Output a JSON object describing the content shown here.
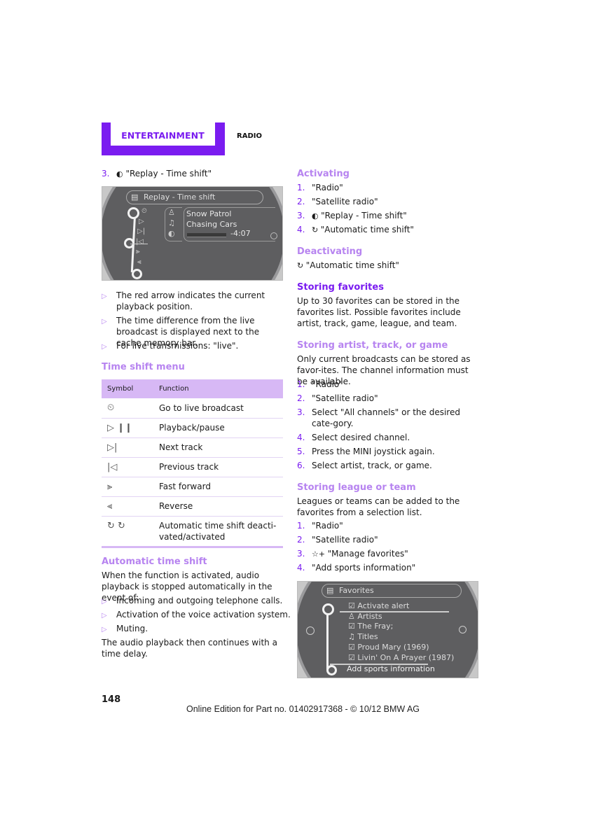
{
  "header": {
    "section": "ENTERTAINMENT",
    "chapter": "RADIO",
    "accent_color": "#7a1cf0",
    "subheading_color": "#b784f0"
  },
  "left": {
    "step3": {
      "num": "3.",
      "icon": "replay-icon",
      "text": "\"Replay - Time shift\""
    },
    "screen1": {
      "title": "Replay - Time shift",
      "artist": "Snow Patrol",
      "track": "Chasing Cars",
      "time": "-4:07",
      "side_icons": [
        "live-icon",
        "play-icon",
        "next-icon",
        "previous-icon",
        "fast-forward-icon",
        "reverse-icon"
      ],
      "info_icons": [
        "artist-icon",
        "music-note-icon",
        "replay-icon"
      ]
    },
    "bullets": [
      "The red arrow indicates the current playback position.",
      "The time difference from the live broadcast is displayed next to the cache memory bar.",
      "For live transmissions: \"live\"."
    ],
    "timeshift_heading": "Time shift menu",
    "table": {
      "headers": [
        "Symbol",
        "Function"
      ],
      "rows": [
        {
          "symbol": "⏲",
          "icon": "live-broadcast-icon",
          "function": "Go to live broadcast"
        },
        {
          "symbol": "▷ ❙❙",
          "icon": "play-pause-icon",
          "function": "Playback/pause"
        },
        {
          "symbol": "▷|",
          "icon": "next-track-icon",
          "function": "Next track"
        },
        {
          "symbol": "|◁",
          "icon": "previous-track-icon",
          "function": "Previous track"
        },
        {
          "symbol": "⫸",
          "icon": "fast-forward-icon",
          "function": "Fast forward"
        },
        {
          "symbol": "⫷",
          "icon": "reverse-icon",
          "function": "Reverse"
        },
        {
          "symbol": "↻ ↻",
          "icon": "auto-time-shift-icon",
          "function": "Automatic time shift deacti-vated/activated"
        }
      ]
    },
    "auto_heading": "Automatic time shift",
    "auto_intro": "When the function is activated, audio playback is stopped automatically in the event of:",
    "auto_bullets": [
      "Incoming and outgoing telephone calls.",
      "Activation of the voice activation system.",
      "Muting."
    ],
    "auto_outro": "The audio playback then continues with a time delay."
  },
  "right": {
    "activating_heading": "Activating",
    "activating_steps": [
      {
        "num": "1.",
        "text": "\"Radio\""
      },
      {
        "num": "2.",
        "text": "\"Satellite radio\""
      },
      {
        "num": "3.",
        "text": "\"Replay - Time shift\""
      },
      {
        "num": "4.",
        "text": "\"Automatic time shift\""
      }
    ],
    "deactivating_heading": "Deactivating",
    "deactivating_text": "\"Automatic time shift\"",
    "storing_heading": "Storing favorites",
    "storing_text": "Up to 30 favorites can be stored in the favorites list. Possible favorites include artist, track, game, league, and team.",
    "artist_heading": "Storing artist, track, or game",
    "artist_text": "Only current broadcasts can be stored as favor-ites. The channel information must be available.",
    "artist_steps": [
      {
        "num": "1.",
        "text": "\"Radio\""
      },
      {
        "num": "2.",
        "text": "\"Satellite radio\""
      },
      {
        "num": "3.",
        "text": "Select \"All channels\" or the desired cate-gory."
      },
      {
        "num": "4.",
        "text": "Select desired channel."
      },
      {
        "num": "5.",
        "text": "Press the MINI joystick again."
      },
      {
        "num": "6.",
        "text": "Select artist, track, or game."
      }
    ],
    "league_heading": "Storing league or team",
    "league_text": "Leagues or teams can be added to the favorites from a selection list.",
    "league_steps": [
      {
        "num": "1.",
        "text": "\"Radio\""
      },
      {
        "num": "2.",
        "text": "\"Satellite radio\""
      },
      {
        "num": "3.",
        "text": "\"Manage favorites\""
      },
      {
        "num": "4.",
        "text": "\"Add sports information\""
      }
    ],
    "screen2": {
      "title": "Favorites",
      "items": [
        {
          "icon": "checkbox-icon",
          "label": "Activate alert"
        },
        {
          "icon": "artist-icon",
          "label": "Artists"
        },
        {
          "icon": "checkbox-icon",
          "label": "The Fray;"
        },
        {
          "icon": "music-note-icon",
          "label": "Titles"
        },
        {
          "icon": "checkbox-icon",
          "label": "Proud Mary (1969)"
        },
        {
          "icon": "checkbox-icon",
          "label": "Livin' On A Prayer (1987)"
        }
      ],
      "action": "Add sports information"
    }
  },
  "footer": {
    "page_number": "148",
    "edition": "Online Edition for Part no. 01402917368 - © 10/12 BMW AG"
  }
}
